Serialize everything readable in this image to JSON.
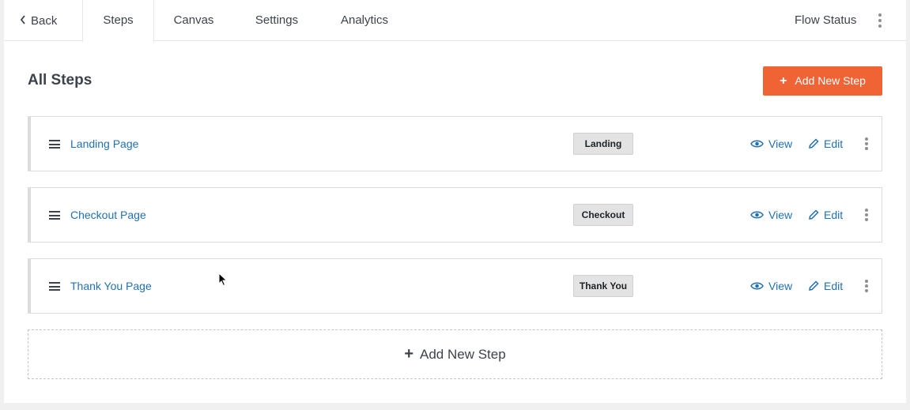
{
  "nav": {
    "back_label": "Back",
    "tabs": [
      {
        "label": "Steps"
      },
      {
        "label": "Canvas"
      },
      {
        "label": "Settings"
      },
      {
        "label": "Analytics"
      }
    ],
    "flow_status_label": "Flow Status"
  },
  "page": {
    "title": "All Steps",
    "add_step_button": "Add New Step"
  },
  "steps": [
    {
      "title": "Landing Page",
      "badge": "Landing",
      "view_label": "View",
      "edit_label": "Edit"
    },
    {
      "title": "Checkout Page",
      "badge": "Checkout",
      "view_label": "View",
      "edit_label": "Edit"
    },
    {
      "title": "Thank You Page",
      "badge": "Thank You",
      "view_label": "View",
      "edit_label": "Edit"
    }
  ],
  "add_step_area": {
    "label": "Add New Step"
  },
  "icons": {
    "back": "chevron-left-icon",
    "more": "kebab-menu-icon",
    "drag": "drag-handle-icon",
    "view": "eye-icon",
    "edit": "pencil-icon",
    "add": "plus-icon"
  },
  "colors": {
    "accent": "#f06335",
    "link": "#2271b1",
    "text": "#3c434a",
    "badge_bg": "#e3e3e3"
  }
}
